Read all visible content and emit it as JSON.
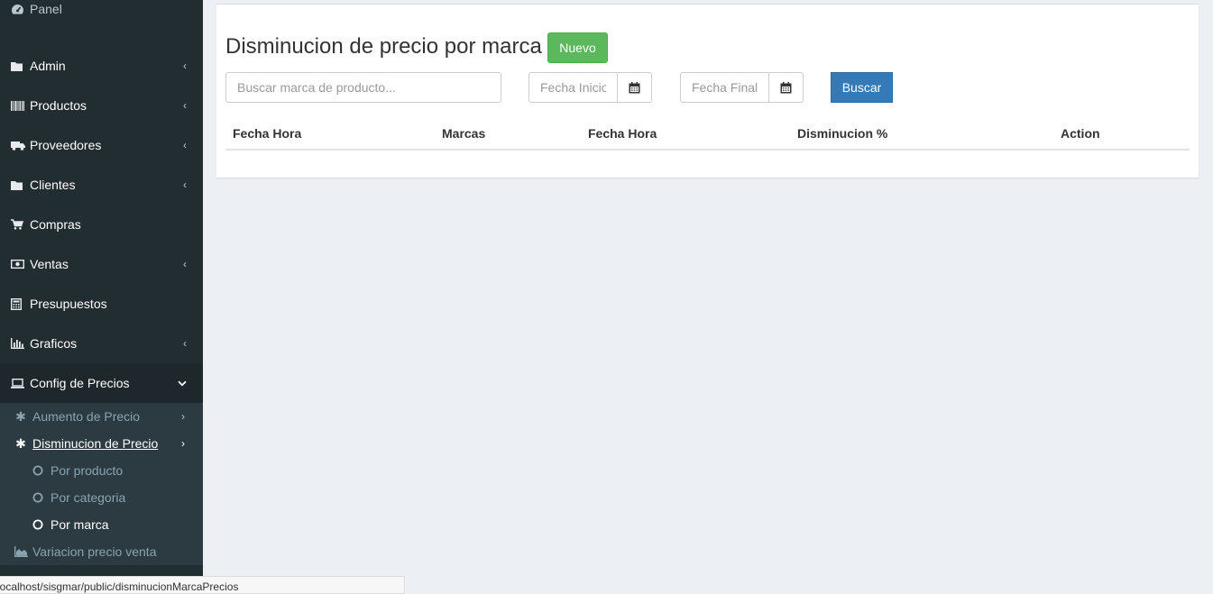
{
  "sidebar": {
    "panel_label": "Panel",
    "items": [
      {
        "label": "Admin",
        "icon": "folder-icon"
      },
      {
        "label": "Productos",
        "icon": "barcode-icon"
      },
      {
        "label": "Proveedores",
        "icon": "truck-icon"
      },
      {
        "label": "Clientes",
        "icon": "folder-icon"
      },
      {
        "label": "Compras",
        "icon": "shopping-cart-icon"
      },
      {
        "label": "Ventas",
        "icon": "money-icon"
      },
      {
        "label": "Presupuestos",
        "icon": "calculator-icon"
      },
      {
        "label": "Graficos",
        "icon": "bar-chart-icon"
      },
      {
        "label": "Config de Precios",
        "icon": "laptop-icon"
      }
    ],
    "submenu": {
      "aumento": "Aumento de Precio",
      "disminucion": "Disminucion de Precio",
      "por_producto": "Por producto",
      "por_categoria": "Por categoria",
      "por_marca": "Por marca",
      "variacion": "Variacion precio venta"
    }
  },
  "main": {
    "title": "Disminucion de precio por marca",
    "new_button": "Nuevo",
    "search_placeholder": "Buscar marca de producto...",
    "date_start_placeholder": "Fecha Inicio",
    "date_end_placeholder": "Fecha Final",
    "search_button": "Buscar",
    "columns": [
      "Fecha Hora",
      "Marcas",
      "Fecha Hora",
      "Disminucion %",
      "Action"
    ]
  },
  "status_url": "localhost/sisgmar/public/disminucionMarcaPrecios",
  "colors": {
    "sidebar_bg": "#222d32",
    "submenu_bg": "#2c3b41",
    "success": "#5cb85c",
    "primary": "#337ab7",
    "page_bg": "#ecf0f5"
  }
}
